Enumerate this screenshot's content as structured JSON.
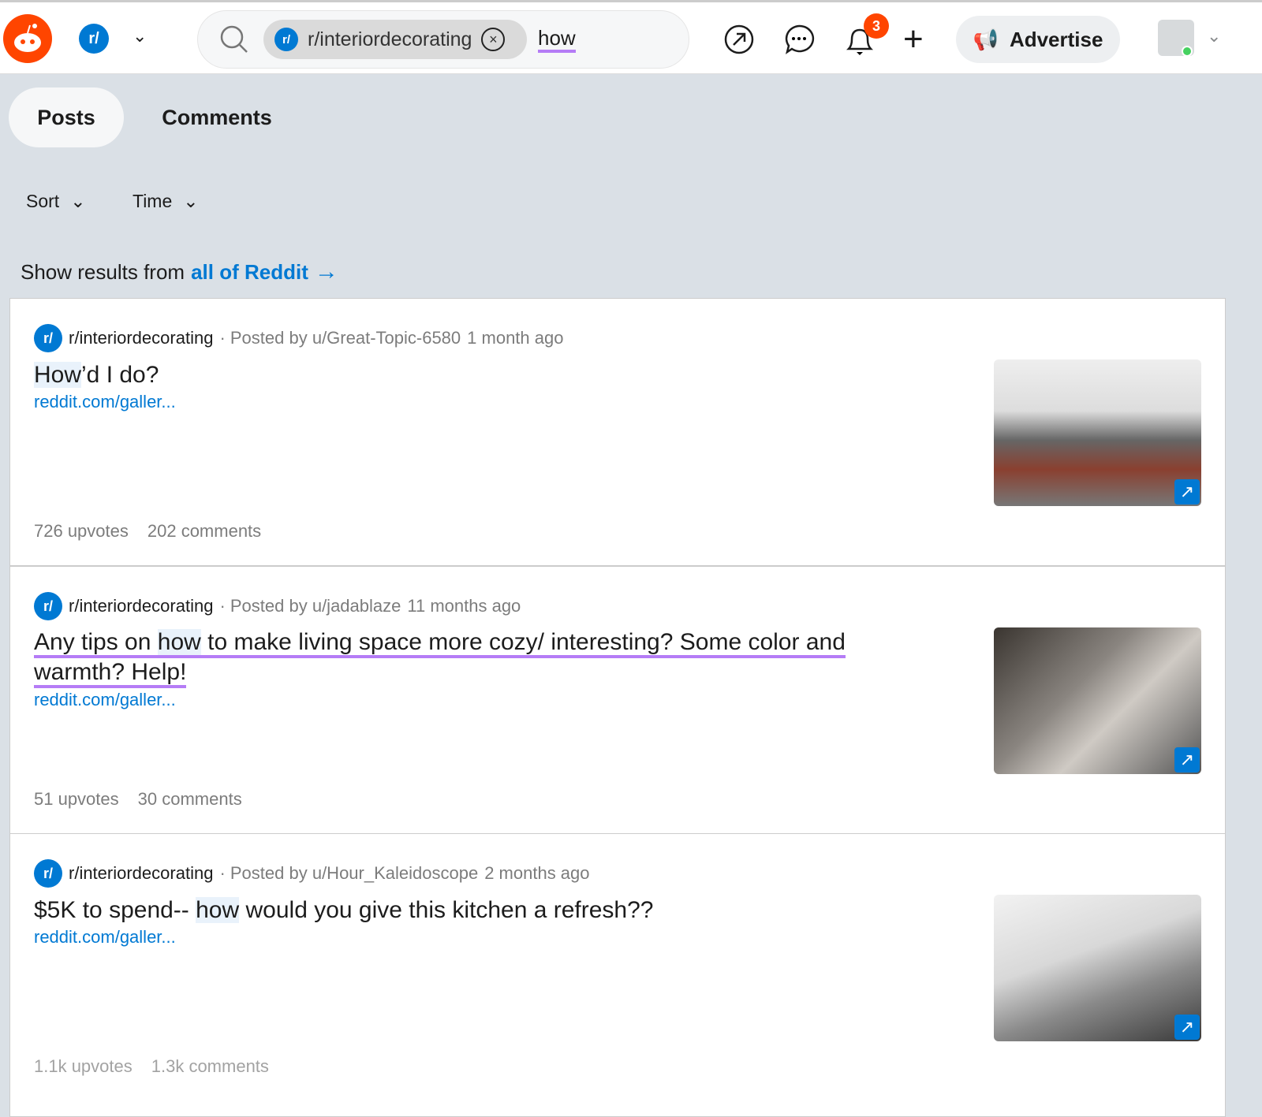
{
  "header": {
    "subreddit_chip": "r/interiordecorating",
    "search_query": "how",
    "notification_count": "3",
    "advertise_label": "Advertise",
    "r_badge": "r/"
  },
  "tabs": [
    {
      "label": "Posts",
      "active": true
    },
    {
      "label": "Comments",
      "active": false
    }
  ],
  "filters": {
    "sort": "Sort",
    "time": "Time"
  },
  "show_results": {
    "prefix": "Show results from",
    "link": "all of Reddit"
  },
  "posts": [
    {
      "subreddit": "r/interiordecorating",
      "posted_by": "· Posted by u/Great-Topic-6580",
      "age": "1 month ago",
      "title_pre": "",
      "title_hl": "How",
      "title_post": "’d I do?",
      "link": "reddit.com/galler...",
      "upvotes": "726 upvotes",
      "comments": "202 comments"
    },
    {
      "subreddit": "r/interiordecorating",
      "posted_by": "· Posted by u/jadablaze",
      "age": "11 months ago",
      "title_pre": "Any tips on ",
      "title_hl": "how",
      "title_post": " to make living space more cozy/ interesting? Some color and warmth? Help!",
      "link": "reddit.com/galler...",
      "upvotes": "51 upvotes",
      "comments": "30 comments"
    },
    {
      "subreddit": "r/interiordecorating",
      "posted_by": "· Posted by u/Hour_Kaleidoscope",
      "age": "2 months ago",
      "title_pre": "$5K to spend-- ",
      "title_hl": "how",
      "title_post": " would you give this kitchen a refresh??",
      "link": "reddit.com/galler...",
      "upvotes": "1.1k upvotes",
      "comments": "1.3k comments"
    }
  ],
  "colors": {
    "brand": "#ff4500",
    "accent": "#0079d3",
    "highlight_underline": "#b57cf6",
    "background": "#dae0e6"
  }
}
